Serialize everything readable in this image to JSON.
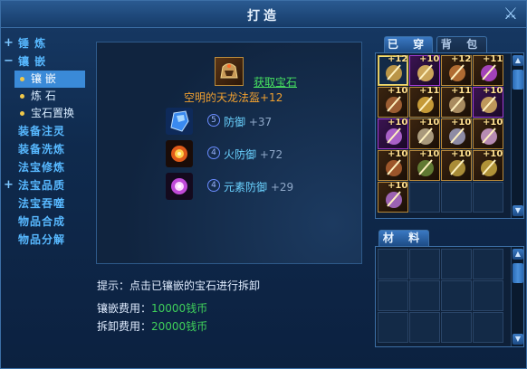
{
  "window": {
    "title": "打造",
    "close_icon": "close-x-icon"
  },
  "nav": {
    "items": [
      {
        "label": "锤 炼",
        "sign": "+"
      },
      {
        "label": "镶 嵌",
        "sign": "−"
      },
      {
        "label": "镶 嵌",
        "sub": true,
        "active": true
      },
      {
        "label": "炼 石",
        "sub": true
      },
      {
        "label": "宝石置换",
        "sub": true
      },
      {
        "label": "装备注灵"
      },
      {
        "label": "装备洗炼"
      },
      {
        "label": "法宝修炼"
      },
      {
        "label": "法宝品质",
        "sign": "+"
      },
      {
        "label": "法宝吞噬"
      },
      {
        "label": "物品合成"
      },
      {
        "label": "物品分解"
      }
    ]
  },
  "center": {
    "get_gem_link": "获取宝石",
    "item_name": "空明的天龙法盔+12",
    "gems": [
      {
        "level": "5",
        "attr": "防御",
        "value": "+37",
        "color": "#3a6ee0"
      },
      {
        "level": "4",
        "attr": "火防御",
        "value": "+72",
        "color": "#e05a1a"
      },
      {
        "level": "4",
        "attr": "元素防御",
        "value": "+29",
        "color": "#c04ad8"
      }
    ]
  },
  "hint": "提示：点击已镶嵌的宝石进行拆卸",
  "costs": {
    "inlay_label": "镶嵌费用：",
    "inlay_value": "10000钱币",
    "remove_label": "拆卸费用：",
    "remove_value": "20000钱币"
  },
  "tabs": {
    "equipped": "已 穿",
    "bag": "背 包",
    "materials": "材 料"
  },
  "inventory": {
    "counts": [
      "+12",
      "+10",
      "+12",
      "+11",
      "+10",
      "+11",
      "+11",
      "+10",
      "+10",
      "+10",
      "+10",
      "+10",
      "+10",
      "+10",
      "+10",
      "+10",
      "+10"
    ]
  },
  "colors": {
    "accent": "#3a8ad8",
    "nav_text": "#57b8ff",
    "cost_value": "#3fd05a",
    "item_name": "#f0a030"
  }
}
